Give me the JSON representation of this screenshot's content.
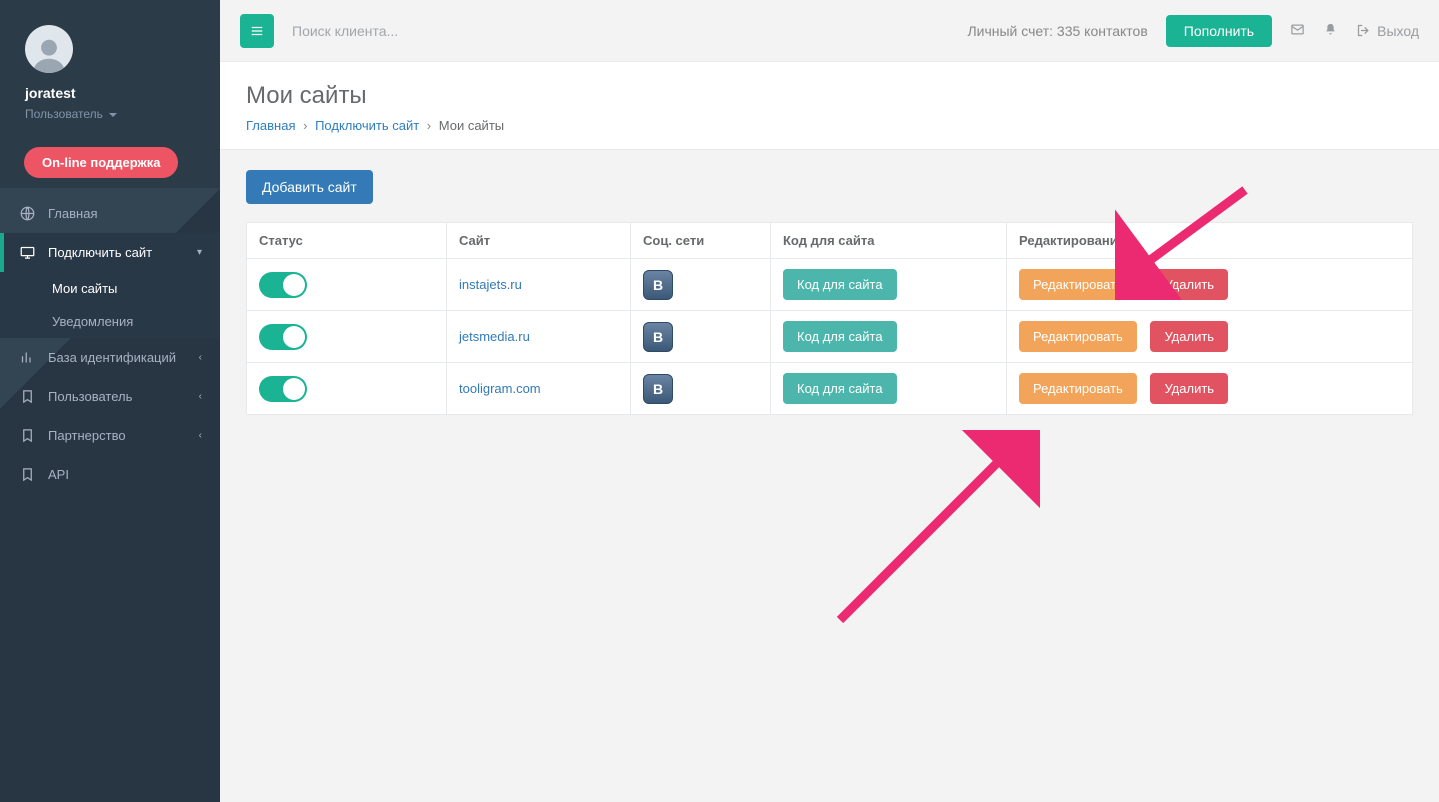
{
  "sidebar": {
    "username": "joratest",
    "role": "Пользователь",
    "support_btn": "On-line поддержка",
    "items": [
      {
        "label": "Главная"
      },
      {
        "label": "Подключить сайт"
      },
      {
        "label": "База идентификаций"
      },
      {
        "label": "Пользователь"
      },
      {
        "label": "Партнерство"
      },
      {
        "label": "API"
      }
    ],
    "sub_connect": [
      {
        "label": "Мои сайты"
      },
      {
        "label": "Уведомления"
      }
    ]
  },
  "topbar": {
    "search_placeholder": "Поиск клиента...",
    "account_text": "Личный счет: 335 контактов",
    "topup": "Пополнить",
    "exit": "Выход"
  },
  "page": {
    "title": "Мои сайты",
    "crumbs": {
      "home": "Главная",
      "connect": "Подключить сайт",
      "current": "Мои сайты"
    },
    "add_btn": "Добавить сайт"
  },
  "table": {
    "headers": {
      "status": "Статус",
      "site": "Сайт",
      "social": "Соц. сети",
      "code": "Код для сайта",
      "edit": "Редактирование"
    },
    "code_btn": "Код для сайта",
    "edit_btn": "Редактировать",
    "del_btn": "Удалить",
    "rows": [
      {
        "enabled": true,
        "site": "instajets.ru"
      },
      {
        "enabled": true,
        "site": "jetsmedia.ru"
      },
      {
        "enabled": true,
        "site": "tooligram.com"
      }
    ]
  }
}
